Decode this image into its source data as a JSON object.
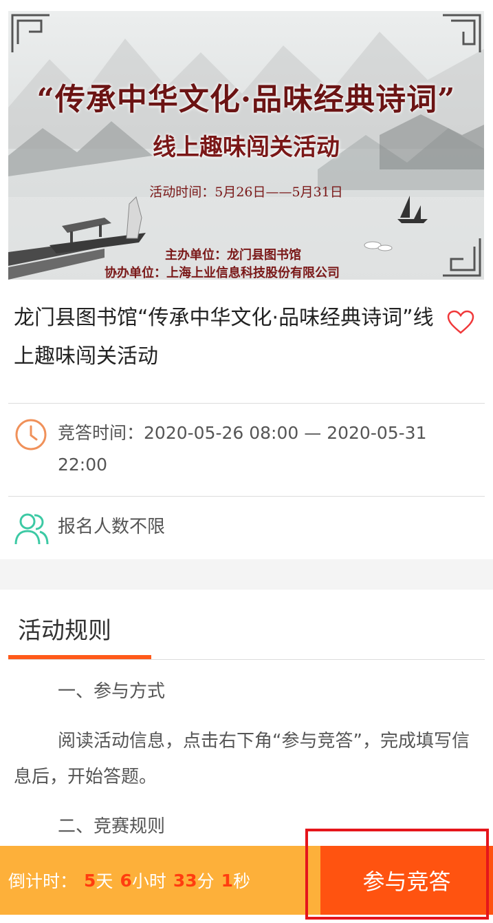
{
  "banner": {
    "title": "“传承中华文化·品味经典诗词”",
    "subtitle": "线上趣味闯关活动",
    "time": "活动时间：5月26日——5月31日",
    "host": "主办单位：龙门县图书馆",
    "co_host": "协办单位：上海上业信息科技股份有限公司"
  },
  "activity": {
    "title": "龙门县图书馆“传承中华文化·品味经典诗词”线上趣味闯关活动",
    "favorite_icon": "heart-icon"
  },
  "info": {
    "time_label": "竞答时间：",
    "time_value": "2020-05-26 08:00 — 2020-05-31 22:00",
    "time_icon": "clock-icon",
    "people_text": "报名人数不限",
    "people_icon": "users-icon"
  },
  "rules": {
    "tab_label": "活动规则",
    "p1": "一、参与方式",
    "p2": "阅读活动信息，点击右下角“参与竞答”，完成填写信息后，开始答题。",
    "p3": "二、竞赛规则"
  },
  "bottom": {
    "countdown_label": "倒计时：",
    "days": "5",
    "days_unit": "天",
    "hours": "6",
    "hours_unit": "小时",
    "minutes": "33",
    "minutes_unit": "分",
    "seconds": "1",
    "seconds_unit": "秒",
    "join_label": "参与竞答"
  },
  "colors": {
    "accent": "#ff5310",
    "countdown_bg": "#fdb03a",
    "highlight": "#e5151b",
    "clock": "#f0915a",
    "users": "#3cc9a4"
  }
}
